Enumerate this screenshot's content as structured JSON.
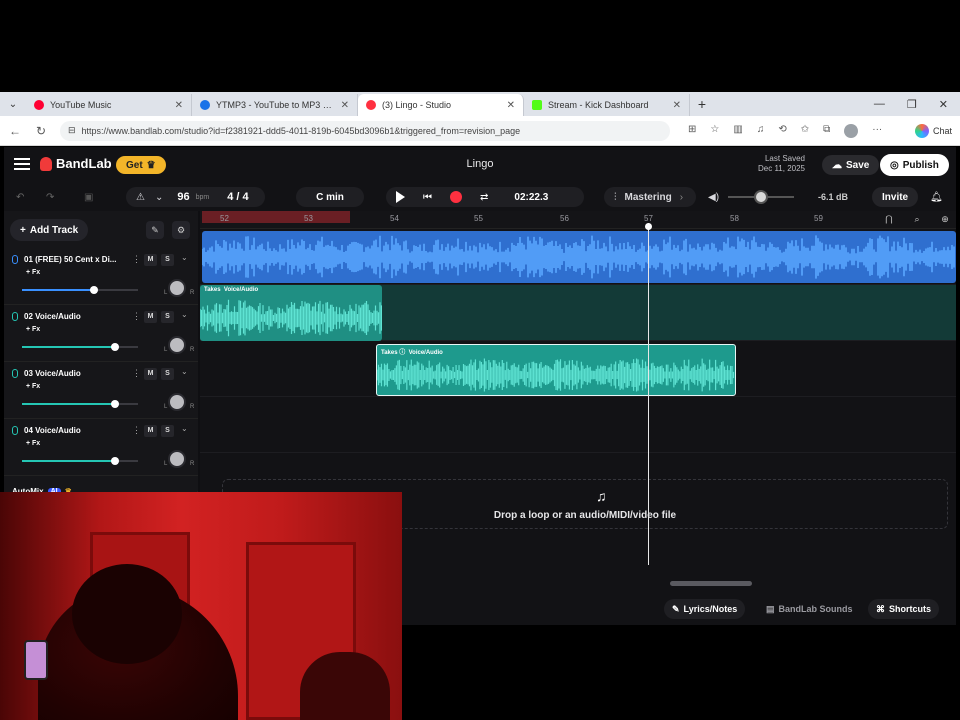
{
  "browser": {
    "tabs": [
      {
        "label": "YouTube Music",
        "favicon_color": "#ff0033",
        "active": false
      },
      {
        "label": "YTMP3 - YouTube to MP3 Convert",
        "favicon_color": "#1a73e8",
        "active": false
      },
      {
        "label": "(3) Lingo - Studio",
        "favicon_color": "#ff3040",
        "active": true
      },
      {
        "label": "Stream - Kick Dashboard",
        "favicon_color": "#53fc18",
        "active": false
      }
    ],
    "new_tab": "+",
    "url": "https://www.bandlab.com/studio?id=f2381921-ddd5-4011-819b-6045bd3096b1&triggered_from=revision_page",
    "copilot_label": "Chat"
  },
  "app": {
    "logo": "BandLab",
    "get_label": "Get",
    "project_title": "Lingo",
    "last_saved_label": "Last Saved",
    "last_saved_date": "Dec 11, 2025",
    "save_label": "Save",
    "publish_label": "Publish",
    "tempo": "96",
    "tempo_unit": "bpm",
    "time_signature": "4 / 4",
    "key": "C min",
    "time": "02:22.3",
    "mastering_label": "Mastering",
    "volume_db": "-6.1 dB",
    "invite_label": "Invite",
    "notification_count": "2"
  },
  "tracks_panel": {
    "add_track_label": "Add Track",
    "tracks": [
      {
        "name": "01  (FREE) 50 Cent x Di...",
        "fx": "+ Fx",
        "mute": "M",
        "solo": "S",
        "color": "#3a90ff",
        "volume": 0.62
      },
      {
        "name": "02  Voice/Audio",
        "fx": "+ Fx",
        "mute": "M",
        "solo": "S",
        "color": "#25c6b4",
        "volume": 0.8
      },
      {
        "name": "03  Voice/Audio",
        "fx": "+ Fx",
        "mute": "M",
        "solo": "S",
        "color": "#25c6b4",
        "volume": 0.8
      },
      {
        "name": "04  Voice/Audio",
        "fx": "+ Fx",
        "mute": "M",
        "solo": "S",
        "color": "#25c6b4",
        "volume": 0.8
      }
    ],
    "pan_left": "L",
    "pan_right": "R",
    "automix_label": "AutoMix",
    "automix_badge": "AI"
  },
  "timeline": {
    "bars": [
      "52",
      "53",
      "54",
      "55",
      "56",
      "57",
      "58",
      "59"
    ],
    "region_takes_label": "Takes",
    "region_voice_label": "Voice/Audio",
    "drop_text": "Drop a loop or an audio/MIDI/video file"
  },
  "bottom_bar": {
    "lyrics_label": "Lyrics/Notes",
    "sounds_label": "BandLab Sounds",
    "shortcuts_label": "Shortcuts"
  },
  "colors": {
    "accent_red": "#ff3040",
    "track_blue": "#3a90ff",
    "track_teal": "#25c6b4",
    "get_gold": "#f3b529"
  }
}
